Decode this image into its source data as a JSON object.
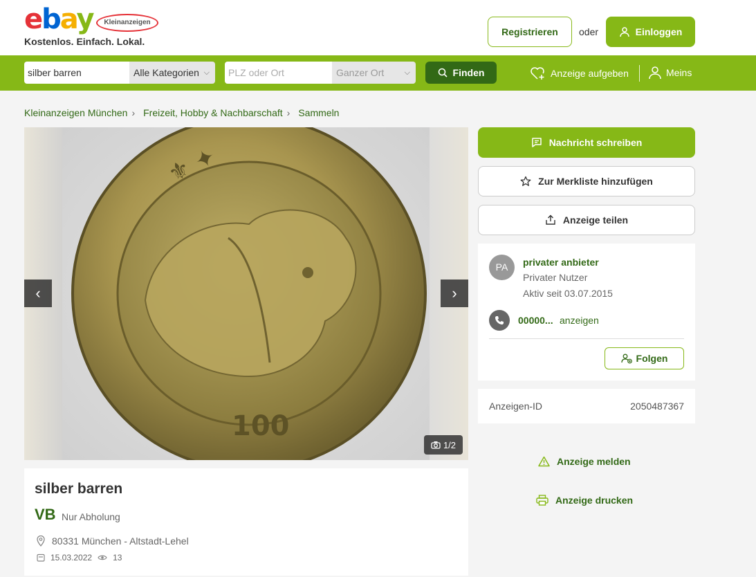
{
  "header": {
    "logo_badge": "Kleinanzeigen",
    "tagline": "Kostenlos. Einfach. Lokal.",
    "register_label": "Registrieren",
    "or_label": "oder",
    "login_label": "Einloggen"
  },
  "search": {
    "query": "silber barren",
    "category": "Alle Kategorien",
    "location_placeholder": "PLZ oder Ort",
    "radius": "Ganzer Ort",
    "find_label": "Finden",
    "post_ad_label": "Anzeige aufgeben",
    "mine_label": "Meins"
  },
  "breadcrumb": {
    "items": [
      "Kleinanzeigen München",
      "Freizeit, Hobby & Nachbarschaft",
      "Sammeln"
    ]
  },
  "gallery": {
    "counter": "1/2"
  },
  "ad": {
    "title": "silber barren",
    "price": "VB",
    "shipping": "Nur Abholung",
    "location": "80331 München - Altstadt-Lehel",
    "date": "15.03.2022",
    "views": "13"
  },
  "actions": {
    "message_label": "Nachricht schreiben",
    "watchlist_label": "Zur Merkliste hinzufügen",
    "share_label": "Anzeige teilen",
    "report_label": "Anzeige melden",
    "print_label": "Anzeige drucken"
  },
  "seller": {
    "initials": "PA",
    "name": "privater anbieter",
    "type": "Privater Nutzer",
    "active_since": "Aktiv seit 03.07.2015",
    "phone": "00000...",
    "phone_reveal": "anzeigen",
    "follow_label": "Folgen"
  },
  "ad_id": {
    "label": "Anzeigen-ID",
    "value": "2050487367"
  },
  "colors": {
    "brand_green": "#86b817",
    "dark_green": "#326916"
  }
}
